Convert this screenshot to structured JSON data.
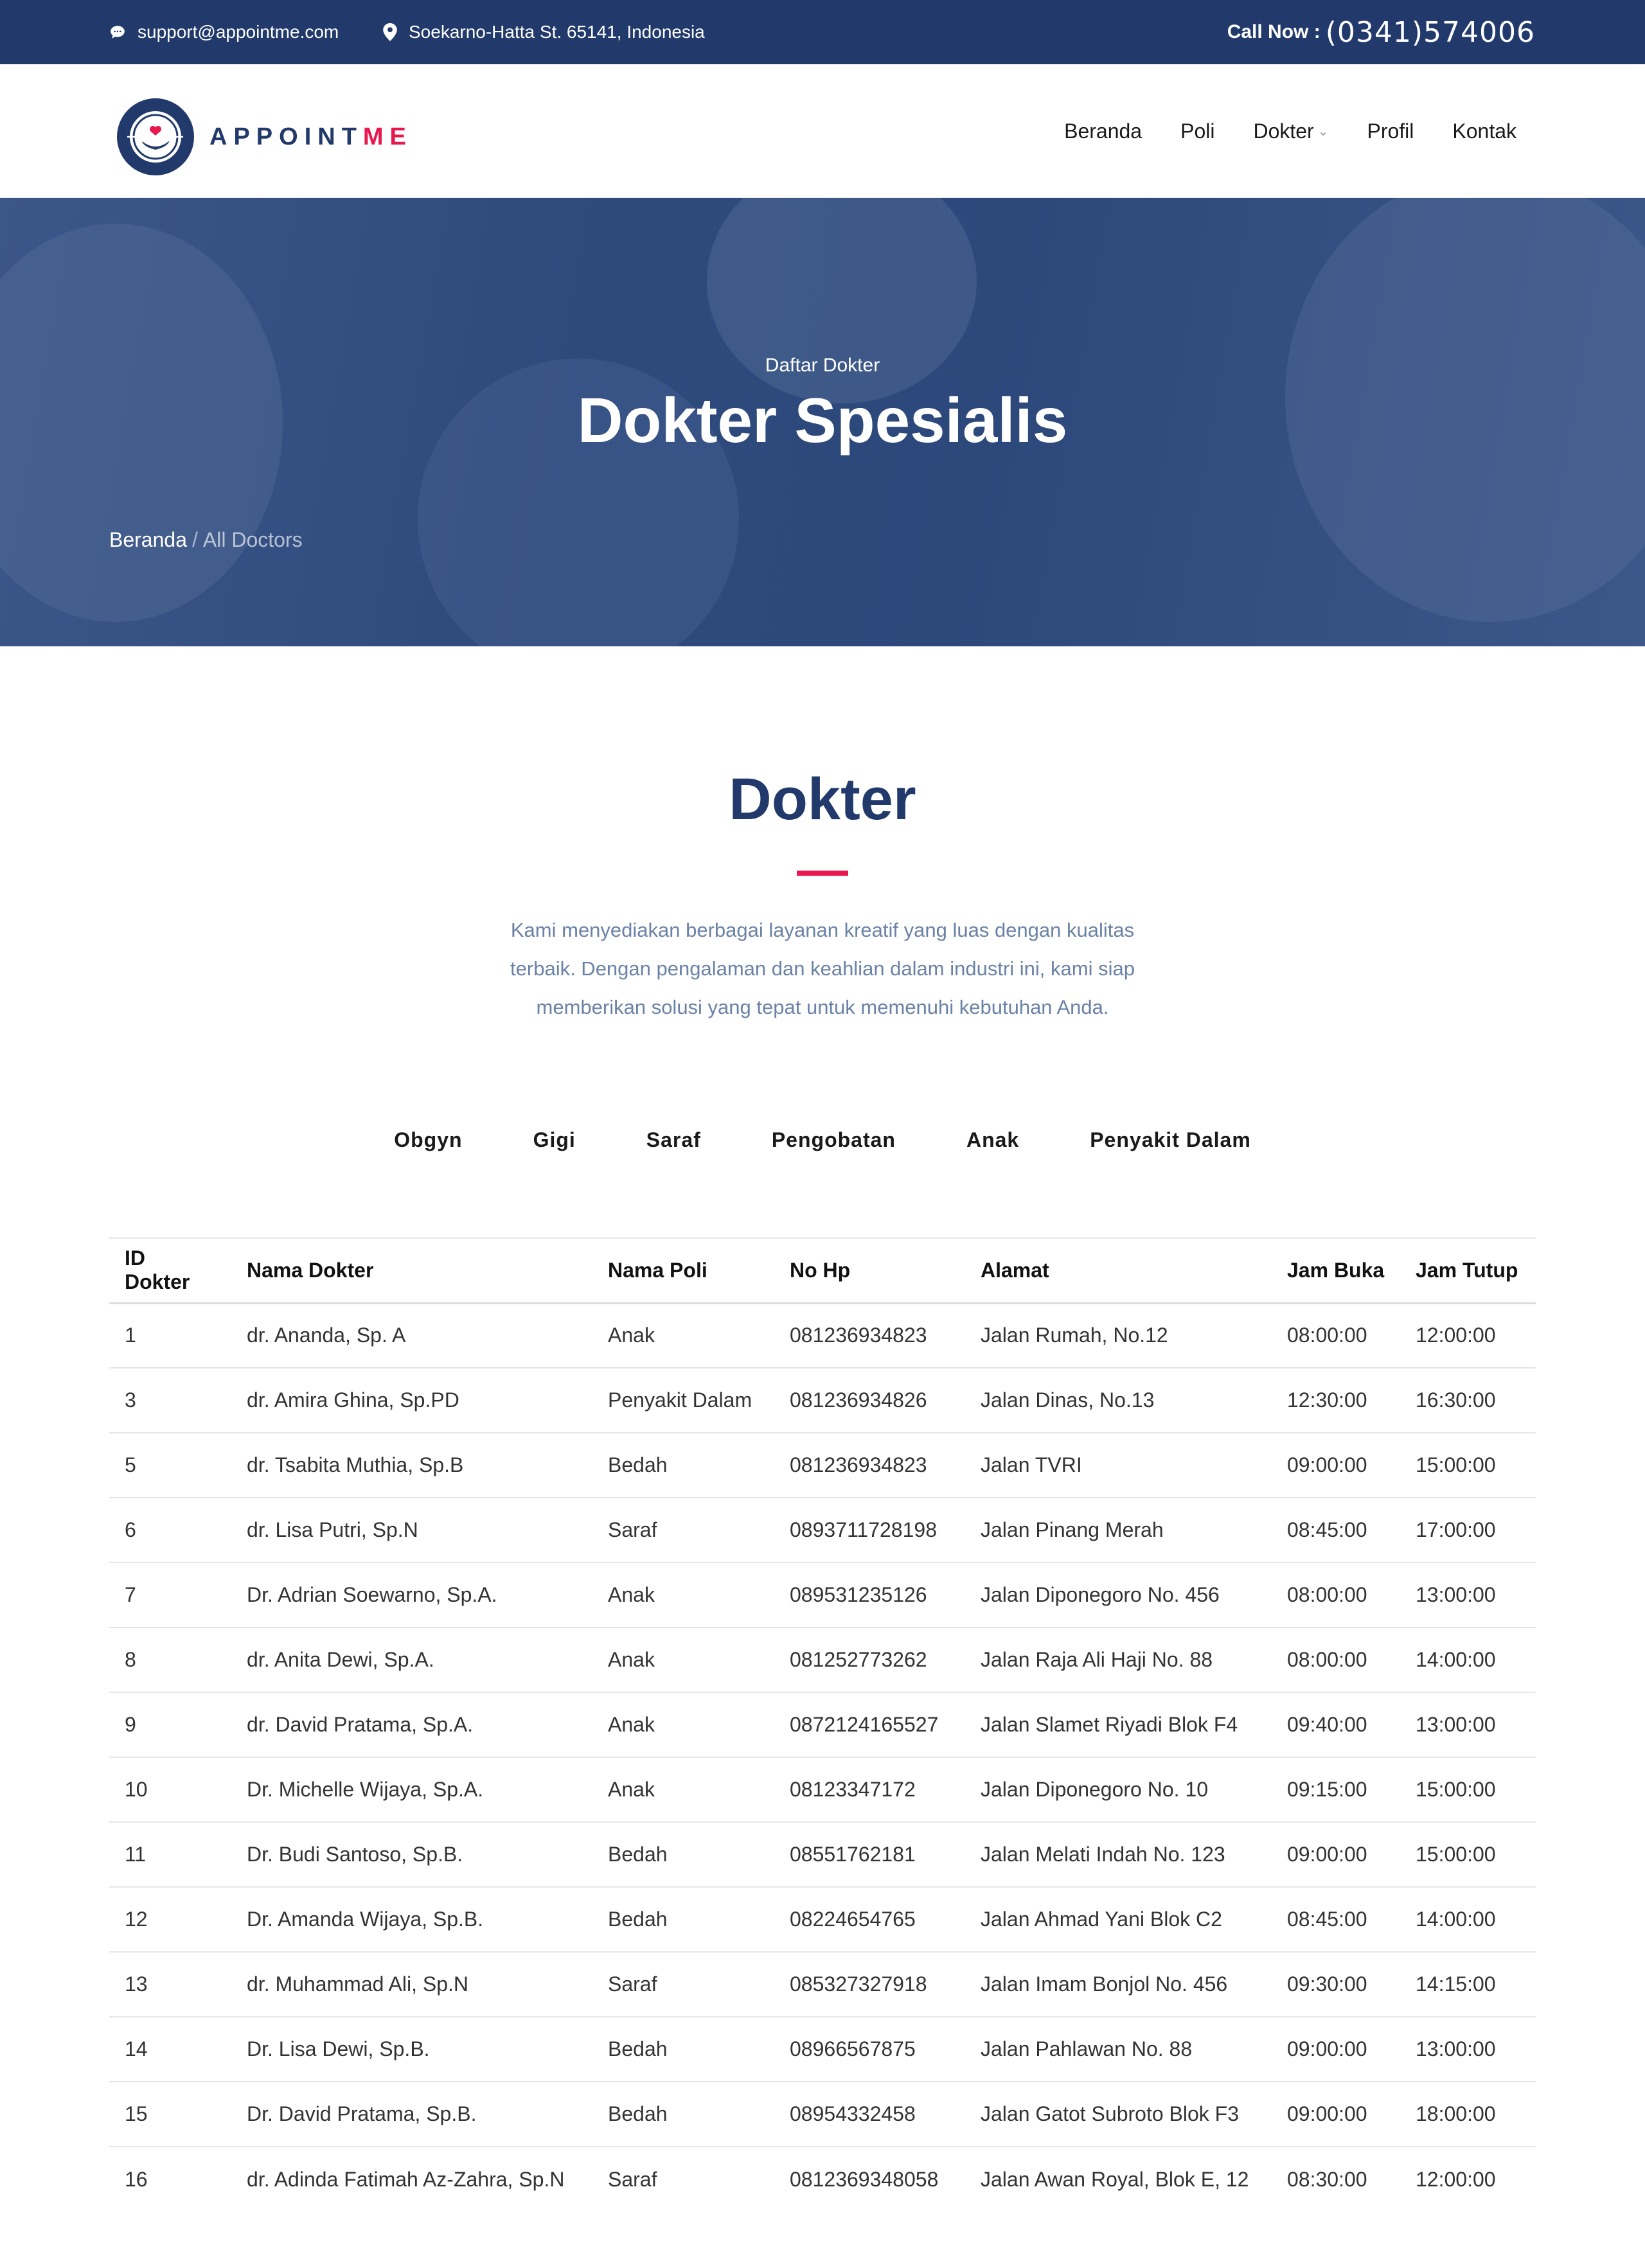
{
  "topbar": {
    "email": "support@appointme.com",
    "address": "Soekarno-Hatta St. 65141, Indonesia",
    "call_label": "Call Now :",
    "call_number": "(0341)574006",
    "bg_color": "#223a6b"
  },
  "header": {
    "logo_text_1": "APPOINT",
    "logo_text_2": "ME",
    "nav": [
      "Beranda",
      "Poli",
      "Dokter",
      "Profil",
      "Kontak"
    ]
  },
  "hero": {
    "subtitle": "Daftar Dokter",
    "title": "Dokter Spesialis",
    "breadcrumb": {
      "home": "Beranda",
      "separator": "/",
      "current": "All Doctors"
    }
  },
  "section": {
    "title": "Dokter",
    "description": "Kami menyediakan berbagai layanan kreatif yang luas dengan kualitas terbaik. Dengan pengalaman dan keahlian dalam industri ini, kami siap memberikan solusi yang tepat untuk memenuhi kebutuhan Anda.",
    "accent_color": "#e8174e"
  },
  "filters": [
    "Obgyn",
    "Gigi",
    "Saraf",
    "Pengobatan",
    "Anak",
    "Penyakit Dalam"
  ],
  "table": {
    "columns": [
      "ID Dokter",
      "Nama Dokter",
      "Nama Poli",
      "No Hp",
      "Alamat",
      "Jam Buka",
      "Jam Tutup"
    ],
    "rows": [
      [
        "1",
        "dr. Ananda, Sp. A",
        "Anak",
        "081236934823",
        "Jalan Rumah, No.12",
        "08:00:00",
        "12:00:00"
      ],
      [
        "3",
        "dr. Amira Ghina, Sp.PD",
        "Penyakit Dalam",
        "081236934826",
        "Jalan Dinas, No.13",
        "12:30:00",
        "16:30:00"
      ],
      [
        "5",
        "dr. Tsabita Muthia, Sp.B",
        "Bedah",
        "081236934823",
        "Jalan TVRI",
        "09:00:00",
        "15:00:00"
      ],
      [
        "6",
        "dr. Lisa Putri, Sp.N",
        "Saraf",
        "0893711728198",
        "Jalan Pinang Merah",
        "08:45:00",
        "17:00:00"
      ],
      [
        "7",
        "Dr. Adrian Soewarno, Sp.A.",
        "Anak",
        "089531235126",
        "Jalan Diponegoro No. 456",
        "08:00:00",
        "13:00:00"
      ],
      [
        "8",
        "dr. Anita Dewi, Sp.A.",
        "Anak",
        "081252773262",
        "Jalan Raja Ali Haji No. 88",
        "08:00:00",
        "14:00:00"
      ],
      [
        "9",
        "dr. David Pratama, Sp.A.",
        "Anak",
        "0872124165527",
        "Jalan Slamet Riyadi Blok F4",
        "09:40:00",
        "13:00:00"
      ],
      [
        "10",
        "Dr. Michelle Wijaya, Sp.A.",
        "Anak",
        "08123347172",
        "Jalan Diponegoro No. 10",
        "09:15:00",
        "15:00:00"
      ],
      [
        "11",
        "Dr. Budi Santoso, Sp.B.",
        "Bedah",
        "08551762181",
        "Jalan Melati Indah No. 123",
        "09:00:00",
        "15:00:00"
      ],
      [
        "12",
        "Dr. Amanda Wijaya, Sp.B.",
        "Bedah",
        "08224654765",
        "Jalan Ahmad Yani Blok C2",
        "08:45:00",
        "14:00:00"
      ],
      [
        "13",
        "dr. Muhammad Ali, Sp.N",
        "Saraf",
        "085327327918",
        "Jalan Imam Bonjol No. 456",
        "09:30:00",
        "14:15:00"
      ],
      [
        "14",
        "Dr. Lisa Dewi, Sp.B.",
        "Bedah",
        "08966567875",
        "Jalan Pahlawan No. 88",
        "09:00:00",
        "13:00:00"
      ],
      [
        "15",
        "Dr. David Pratama, Sp.B.",
        "Bedah",
        "08954332458",
        "Jalan Gatot Subroto Blok F3",
        "09:00:00",
        "18:00:00"
      ],
      [
        "16",
        "dr. Adinda Fatimah Az-Zahra, Sp.N",
        "Saraf",
        "0812369348058",
        "Jalan Awan Royal, Blok E, 12",
        "08:30:00",
        "12:00:00"
      ]
    ]
  }
}
